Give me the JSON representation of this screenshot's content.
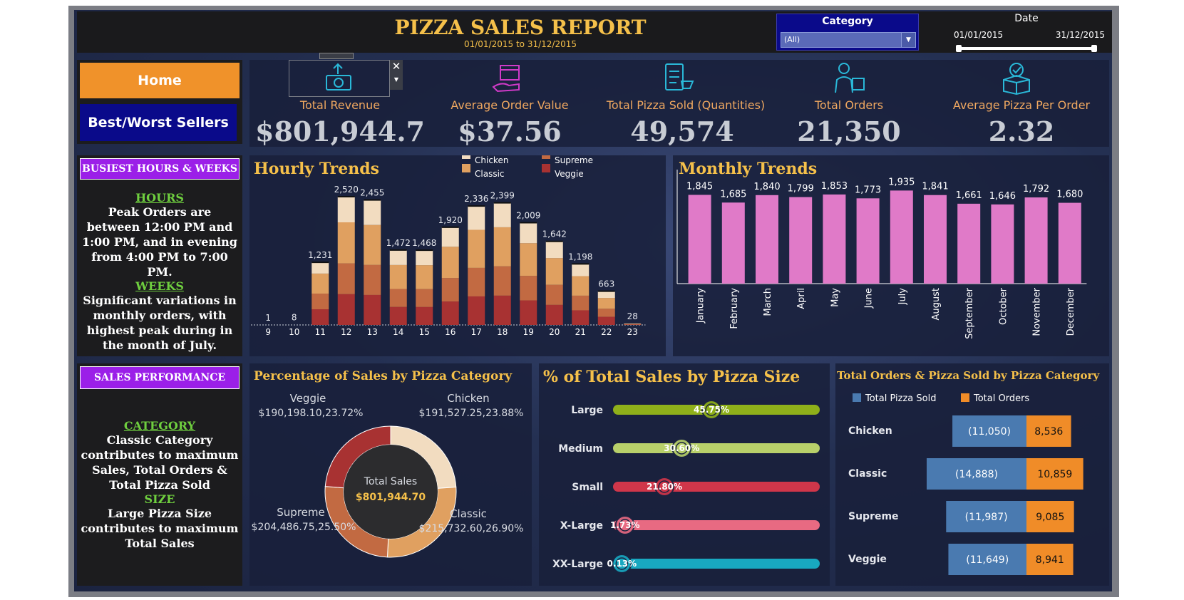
{
  "header": {
    "title": "PIZZA SALES REPORT",
    "date_range": "01/01/2015 to 31/12/2015",
    "category_label": "Category",
    "category_value": "(All)",
    "date_label": "Date",
    "date_start": "01/01/2015",
    "date_end": "31/12/2015"
  },
  "nav": {
    "home": "Home",
    "best_worst": "Best/Worst Sellers"
  },
  "kpis": [
    {
      "label": "Total Revenue",
      "value": "$801,944.7",
      "icon": "money-hand-icon"
    },
    {
      "label": "Average Order Value",
      "value": "$37.56",
      "icon": "box-hand-icon"
    },
    {
      "label": "Total Pizza Sold (Quantities)",
      "value": "49,574",
      "icon": "clipboard-cart-icon"
    },
    {
      "label": "Total Orders",
      "value": "21,350",
      "icon": "delivery-person-icon"
    },
    {
      "label": "Average Pizza Per Order",
      "value": "2.32",
      "icon": "box-check-icon"
    }
  ],
  "busiest": {
    "heading": "BUSIEST HOURS & WEEKS",
    "hours_head": "HOURS",
    "hours_text": "Peak Orders are between 12:00 PM and 1:00 PM, and in evening from 4:00 PM to 7:00 PM.",
    "weeks_head": "WEEKS",
    "weeks_text": "Significant variations in monthly orders, with highest peak during in the month of July."
  },
  "sales_perf": {
    "heading": "SALES PERFORMANCE",
    "category_head": "CATEGORY",
    "category_text": "Classic Category contributes to maximum Sales, Total Orders & Total Pizza Sold",
    "size_head": "SIZE",
    "size_text": "Large Pizza Size contributes to maximum Total Sales"
  },
  "colors": {
    "chicken": "#f2dcc0",
    "classic": "#e0a060",
    "supreme": "#c26a42",
    "veggie": "#a83232",
    "monthly_bar": "#e07ac8",
    "gold": "#f5c04a",
    "pizza_sold": "#4a7ab0",
    "orders": "#f08c28"
  },
  "chart_data": [
    {
      "type": "bar",
      "title": "Hourly Trends",
      "categories": [
        "9",
        "10",
        "11",
        "12",
        "13",
        "14",
        "15",
        "16",
        "17",
        "18",
        "19",
        "20",
        "21",
        "22",
        "23"
      ],
      "totals": [
        1,
        8,
        1231,
        2520,
        2455,
        1472,
        1468,
        1920,
        2336,
        2399,
        2009,
        1642,
        1198,
        663,
        28
      ],
      "total_labels": [
        "1",
        "8",
        "1,231",
        "2,520",
        "2,455",
        "1,472",
        "1,468",
        "1,920",
        "2,336",
        "2,399",
        "2,009",
        "1,642",
        "1,198",
        "663",
        "28"
      ],
      "stacked": true,
      "series": [
        {
          "name": "Chicken",
          "share": [
            0.2,
            0.2,
            0.18,
            0.2,
            0.2,
            0.2,
            0.2,
            0.2,
            0.2,
            0.2,
            0.2,
            0.2,
            0.2,
            0.2,
            0.2
          ]
        },
        {
          "name": "Classic",
          "share": [
            0.32,
            0.32,
            0.32,
            0.32,
            0.32,
            0.32,
            0.32,
            0.32,
            0.32,
            0.32,
            0.32,
            0.32,
            0.32,
            0.32,
            0.32
          ]
        },
        {
          "name": "Supreme",
          "share": [
            0.24,
            0.24,
            0.25,
            0.24,
            0.24,
            0.24,
            0.24,
            0.24,
            0.24,
            0.24,
            0.24,
            0.24,
            0.24,
            0.24,
            0.24
          ]
        },
        {
          "name": "Veggie",
          "share": [
            0.24,
            0.24,
            0.25,
            0.24,
            0.24,
            0.24,
            0.24,
            0.24,
            0.24,
            0.24,
            0.24,
            0.24,
            0.24,
            0.24,
            0.24
          ]
        }
      ],
      "legend": "top-right"
    },
    {
      "type": "bar",
      "title": "Monthly Trends",
      "categories": [
        "January",
        "February",
        "March",
        "April",
        "May",
        "June",
        "July",
        "August",
        "September",
        "October",
        "November",
        "December"
      ],
      "values": [
        1845,
        1685,
        1840,
        1799,
        1853,
        1773,
        1935,
        1841,
        1661,
        1646,
        1792,
        1680
      ],
      "labels": [
        "1,845",
        "1,685",
        "1,840",
        "1,799",
        "1,853",
        "1,773",
        "1,935",
        "1,841",
        "1,661",
        "1,646",
        "1,792",
        "1,680"
      ]
    },
    {
      "type": "pie",
      "title": "Percentage of Sales by Pizza Category",
      "center_label": "Total Sales",
      "center_value": "$801,944.70",
      "slices": [
        {
          "name": "Chicken",
          "value": 191527.25,
          "pct": 23.88,
          "label": "$191,527.25,23.88%"
        },
        {
          "name": "Classic",
          "value": 215732.6,
          "pct": 26.9,
          "label": "$215,732.60,26.90%"
        },
        {
          "name": "Supreme",
          "value": 204486.75,
          "pct": 25.5,
          "label": "$204,486.75,25.50%"
        },
        {
          "name": "Veggie",
          "value": 190198.1,
          "pct": 23.72,
          "label": "$190,198.10,23.72%"
        }
      ]
    },
    {
      "type": "bar",
      "title": "% of Total Sales by Pizza Size",
      "categories": [
        "Large",
        "Medium",
        "Small",
        "X-Large",
        "XX-Large"
      ],
      "values": [
        45.75,
        30.6,
        21.8,
        1.73,
        0.13
      ],
      "labels": [
        "45.75%",
        "30.60%",
        "21.80%",
        "1.73%",
        "0.13%"
      ],
      "colors": [
        "#8fb01a",
        "#b8d06a",
        "#d0364a",
        "#e86a82",
        "#18a8c0"
      ]
    },
    {
      "type": "bar",
      "title": "Total Orders & Pizza Sold by Pizza Category",
      "categories": [
        "Chicken",
        "Classic",
        "Supreme",
        "Veggie"
      ],
      "series": [
        {
          "name": "Total Pizza Sold",
          "values": [
            11050,
            14888,
            11987,
            11649
          ],
          "labels": [
            "(11,050)",
            "(14,888)",
            "(11,987)",
            "(11,649)"
          ]
        },
        {
          "name": "Total Orders",
          "values": [
            8536,
            10859,
            9085,
            8941
          ],
          "labels": [
            "8,536",
            "10,859",
            "9,085",
            "8,941"
          ]
        }
      ],
      "legend": "top"
    }
  ]
}
